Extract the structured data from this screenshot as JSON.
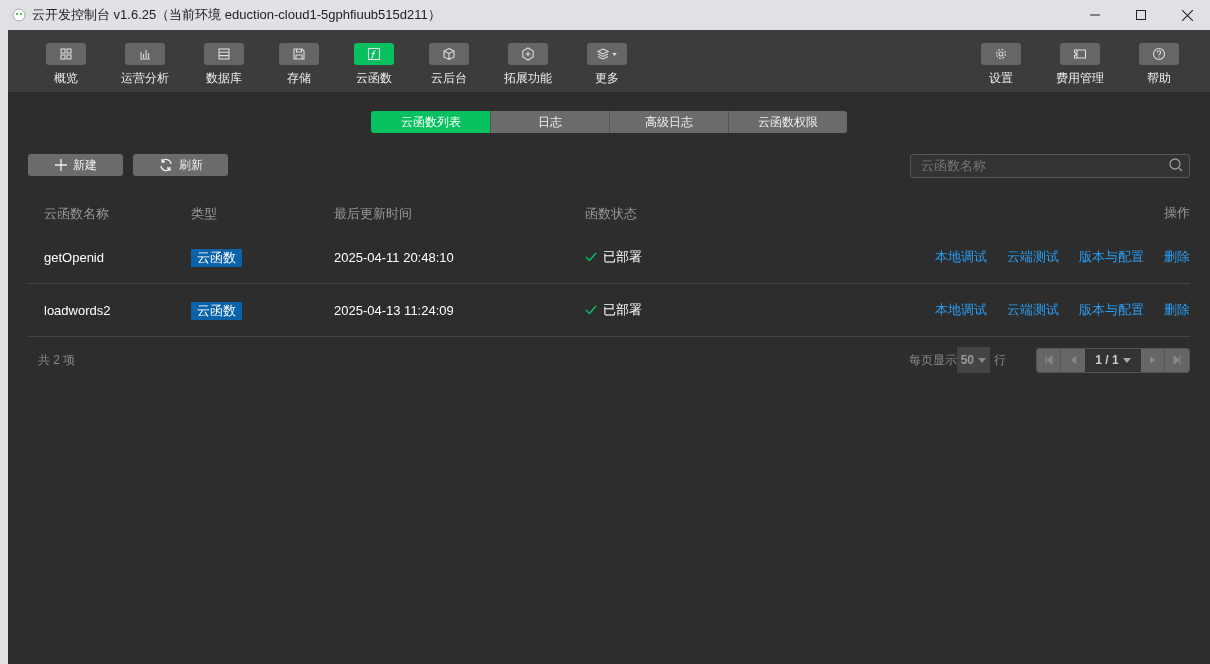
{
  "window": {
    "title": "云开发控制台 v1.6.25（当前环境 eduction-cloud1-5gphfiuub515d211）"
  },
  "nav": [
    {
      "label": "概览",
      "kind": "grid",
      "selected": false
    },
    {
      "label": "运营分析",
      "kind": "chart",
      "selected": false
    },
    {
      "label": "数据库",
      "kind": "database",
      "selected": false
    },
    {
      "label": "存储",
      "kind": "floppy",
      "selected": false
    },
    {
      "label": "云函数",
      "kind": "function",
      "selected": true
    },
    {
      "label": "云后台",
      "kind": "cube",
      "selected": false
    },
    {
      "label": "拓展功能",
      "kind": "extend",
      "selected": false
    },
    {
      "label": "更多",
      "kind": "layers",
      "selected": false
    }
  ],
  "nav_right": [
    {
      "label": "设置",
      "kind": "gear"
    },
    {
      "label": "费用管理",
      "kind": "ticket"
    },
    {
      "label": "帮助",
      "kind": "help"
    }
  ],
  "tabs": [
    {
      "label": "云函数列表",
      "selected": true
    },
    {
      "label": "日志",
      "selected": false
    },
    {
      "label": "高级日志",
      "selected": false
    },
    {
      "label": "云函数权限",
      "selected": false
    }
  ],
  "actions": [
    {
      "label": "新建",
      "kind": "plus"
    },
    {
      "label": "刷新",
      "kind": "refresh"
    }
  ],
  "search": {
    "placeholder": "云函数名称"
  },
  "table": {
    "columns": [
      "云函数名称",
      "类型",
      "最后更新时间",
      "函数状态",
      "操作"
    ],
    "rows": [
      {
        "name": "getOpenid",
        "type": "云函数",
        "updated": "2025-04-11 20:48:10",
        "status": "已部署",
        "actions": [
          "本地调试",
          "云端测试",
          "版本与配置",
          "删除"
        ]
      },
      {
        "name": "loadwords2",
        "type": "云函数",
        "updated": "2025-04-13 11:24:09",
        "status": "已部署",
        "actions": [
          "本地调试",
          "云端测试",
          "版本与配置",
          "删除"
        ]
      }
    ]
  },
  "footer": {
    "total": "共 2 项",
    "per_page_label": "每页显示",
    "per_page": "50",
    "per_page_unit": "行",
    "page": "1 / 1"
  }
}
